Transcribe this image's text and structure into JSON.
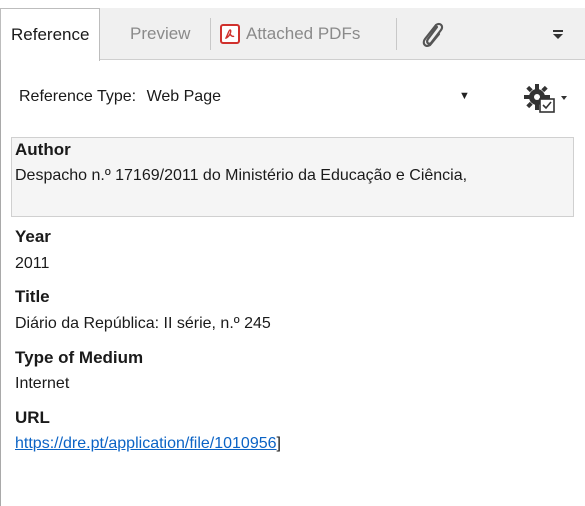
{
  "tabs": [
    {
      "label": "Reference",
      "active": true
    },
    {
      "label": "Preview",
      "active": false
    },
    {
      "label": "Attached PDFs",
      "active": false
    }
  ],
  "icons": {
    "pdf": "pdf-icon",
    "attach": "paperclip-icon",
    "menu": "dropdown-arrow-icon",
    "settings": "gear-settings-icon"
  },
  "reference": {
    "type_label": "Reference Type:",
    "type_value": "Web Page"
  },
  "fields": {
    "author": {
      "label": "Author",
      "value": "Despacho n.º 17169/2011 do Ministério da Educação e Ciência,"
    },
    "year": {
      "label": "Year",
      "value": "2011"
    },
    "title": {
      "label": "Title",
      "value": "Diário da República: II série, n.º 245"
    },
    "medium": {
      "label": "Type of Medium",
      "value": "Internet"
    },
    "url": {
      "label": "URL",
      "value": "https://dre.pt/application/file/1010956",
      "suffix": "]"
    }
  },
  "colors": {
    "link": "#0b63c5",
    "pdf_red": "#d0312d"
  }
}
